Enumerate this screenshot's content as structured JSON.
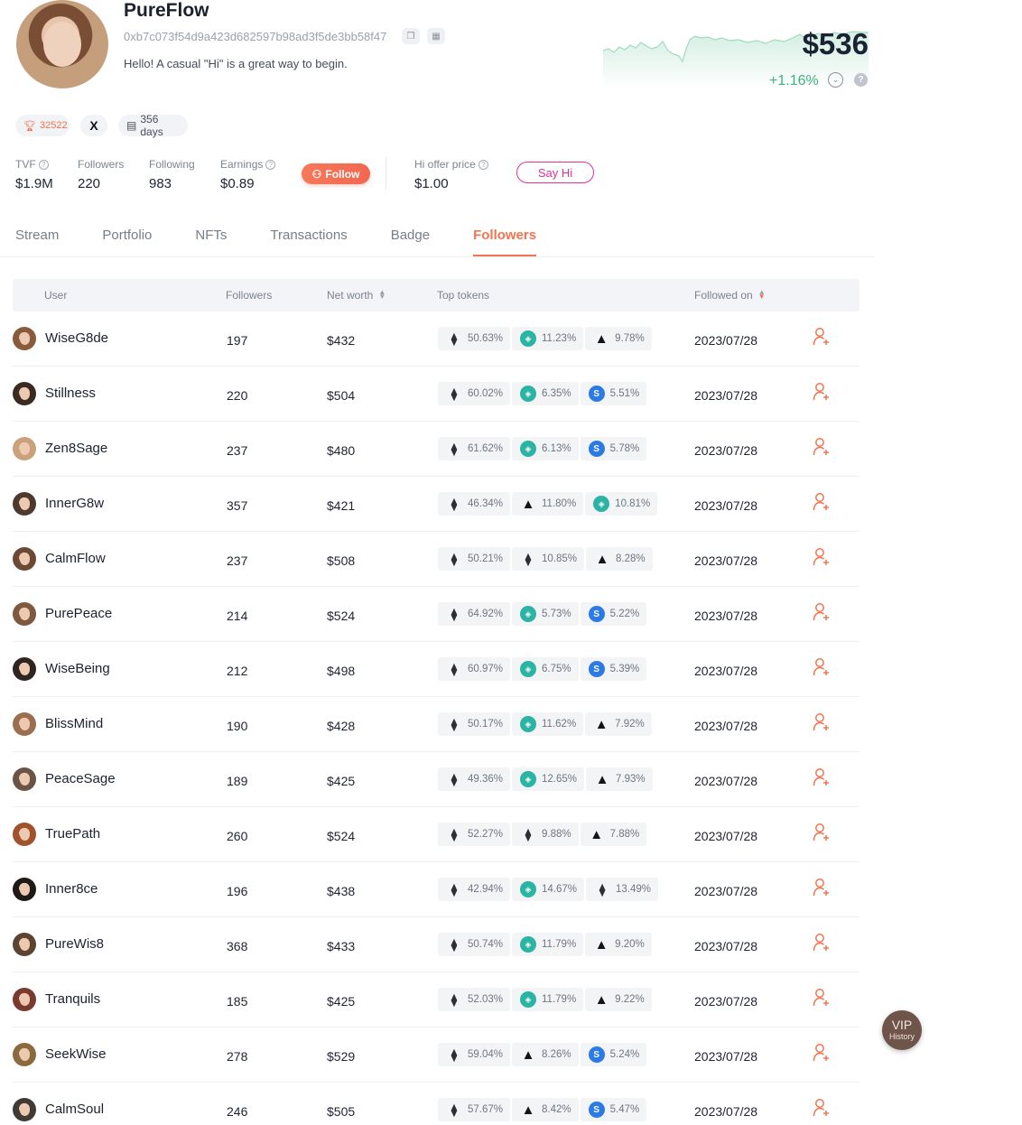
{
  "profile": {
    "name": "PureFlow",
    "address": "0xb7c073f54d9a423d682597b98ad3f5de3bb58f47",
    "bio": "Hello! A casual \"Hi\" is a great way to begin.",
    "price": "$536",
    "change": "+1.16%",
    "trophy_score": "32522",
    "days": "356 days",
    "x_label": "X"
  },
  "stats": {
    "tvf_label": "TVF",
    "tvf": "$1.9M",
    "followers_label": "Followers",
    "followers": "220",
    "following_label": "Following",
    "following": "983",
    "earnings_label": "Earnings",
    "earnings": "$0.89",
    "hi_offer_label": "Hi offer price",
    "hi_offer": "$1.00"
  },
  "buttons": {
    "follow": "Follow",
    "say_hi": "Say Hi"
  },
  "tabs": [
    {
      "label": "Stream"
    },
    {
      "label": "Portfolio"
    },
    {
      "label": "NFTs"
    },
    {
      "label": "Transactions"
    },
    {
      "label": "Badge"
    },
    {
      "label": "Followers",
      "active": true
    }
  ],
  "table": {
    "headers": {
      "user": "User",
      "followers": "Followers",
      "net_worth": "Net worth",
      "top_tokens": "Top tokens",
      "followed_on": "Followed on"
    },
    "rows": [
      {
        "user": "WiseG8de",
        "followers": "197",
        "net_worth": "$432",
        "tokens": [
          [
            "eth",
            "50.63%"
          ],
          [
            "gem",
            "11.23%"
          ],
          [
            "arb",
            "9.78%"
          ]
        ],
        "date": "2023/07/28"
      },
      {
        "user": "Stillness",
        "followers": "220",
        "net_worth": "$504",
        "tokens": [
          [
            "eth",
            "60.02%"
          ],
          [
            "gem",
            "6.35%"
          ],
          [
            "blue",
            "5.51%"
          ]
        ],
        "date": "2023/07/28"
      },
      {
        "user": "Zen8Sage",
        "followers": "237",
        "net_worth": "$480",
        "tokens": [
          [
            "eth",
            "61.62%"
          ],
          [
            "gem",
            "6.13%"
          ],
          [
            "blue",
            "5.78%"
          ]
        ],
        "date": "2023/07/28"
      },
      {
        "user": "InnerG8w",
        "followers": "357",
        "net_worth": "$421",
        "tokens": [
          [
            "eth",
            "46.34%"
          ],
          [
            "arb",
            "11.80%"
          ],
          [
            "gem",
            "10.81%"
          ]
        ],
        "date": "2023/07/28"
      },
      {
        "user": "CalmFlow",
        "followers": "237",
        "net_worth": "$508",
        "tokens": [
          [
            "eth",
            "50.21%"
          ],
          [
            "eth",
            "10.85%"
          ],
          [
            "arb",
            "8.28%"
          ]
        ],
        "date": "2023/07/28"
      },
      {
        "user": "PurePeace",
        "followers": "214",
        "net_worth": "$524",
        "tokens": [
          [
            "eth",
            "64.92%"
          ],
          [
            "gem",
            "5.73%"
          ],
          [
            "blue",
            "5.22%"
          ]
        ],
        "date": "2023/07/28"
      },
      {
        "user": "WiseBeing",
        "followers": "212",
        "net_worth": "$498",
        "tokens": [
          [
            "eth",
            "60.97%"
          ],
          [
            "gem",
            "6.75%"
          ],
          [
            "blue",
            "5.39%"
          ]
        ],
        "date": "2023/07/28"
      },
      {
        "user": "BlissMind",
        "followers": "190",
        "net_worth": "$428",
        "tokens": [
          [
            "eth",
            "50.17%"
          ],
          [
            "gem",
            "11.62%"
          ],
          [
            "arb",
            "7.92%"
          ]
        ],
        "date": "2023/07/28"
      },
      {
        "user": "PeaceSage",
        "followers": "189",
        "net_worth": "$425",
        "tokens": [
          [
            "eth",
            "49.36%"
          ],
          [
            "gem",
            "12.65%"
          ],
          [
            "arb",
            "7.93%"
          ]
        ],
        "date": "2023/07/28"
      },
      {
        "user": "TruePath",
        "followers": "260",
        "net_worth": "$524",
        "tokens": [
          [
            "eth",
            "52.27%"
          ],
          [
            "eth",
            "9.88%"
          ],
          [
            "arb",
            "7.88%"
          ]
        ],
        "date": "2023/07/28"
      },
      {
        "user": "Inner8ce",
        "followers": "196",
        "net_worth": "$438",
        "tokens": [
          [
            "eth",
            "42.94%"
          ],
          [
            "gem",
            "14.67%"
          ],
          [
            "eth",
            "13.49%"
          ]
        ],
        "date": "2023/07/28"
      },
      {
        "user": "PureWis8",
        "followers": "368",
        "net_worth": "$433",
        "tokens": [
          [
            "eth",
            "50.74%"
          ],
          [
            "gem",
            "11.79%"
          ],
          [
            "arb",
            "9.20%"
          ]
        ],
        "date": "2023/07/28"
      },
      {
        "user": "Tranquils",
        "followers": "185",
        "net_worth": "$425",
        "tokens": [
          [
            "eth",
            "52.03%"
          ],
          [
            "gem",
            "11.79%"
          ],
          [
            "arb",
            "9.22%"
          ]
        ],
        "date": "2023/07/28"
      },
      {
        "user": "SeekWise",
        "followers": "278",
        "net_worth": "$529",
        "tokens": [
          [
            "eth",
            "59.04%"
          ],
          [
            "arb",
            "8.26%"
          ],
          [
            "blue",
            "5.24%"
          ]
        ],
        "date": "2023/07/28"
      },
      {
        "user": "CalmSoul",
        "followers": "246",
        "net_worth": "$505",
        "tokens": [
          [
            "eth",
            "57.67%"
          ],
          [
            "arb",
            "8.42%"
          ],
          [
            "blue",
            "5.47%"
          ]
        ],
        "date": "2023/07/28"
      }
    ]
  },
  "vip": {
    "title": "VIP",
    "subtitle": "History"
  },
  "colors": {
    "accent": "#f3734f",
    "positive": "#3bb47a",
    "say_hi": "#e0309b"
  }
}
